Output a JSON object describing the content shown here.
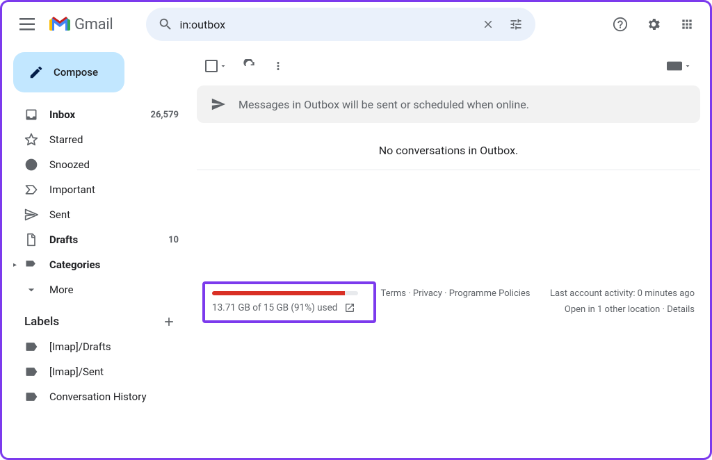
{
  "header": {
    "app_name": "Gmail",
    "search_value": "in:outbox"
  },
  "compose_label": "Compose",
  "nav": [
    {
      "icon": "inbox",
      "label": "Inbox",
      "count": "26,579",
      "bold": true
    },
    {
      "icon": "star",
      "label": "Starred",
      "count": "",
      "bold": false
    },
    {
      "icon": "clock",
      "label": "Snoozed",
      "count": "",
      "bold": false
    },
    {
      "icon": "important",
      "label": "Important",
      "count": "",
      "bold": false
    },
    {
      "icon": "send",
      "label": "Sent",
      "count": "",
      "bold": false
    },
    {
      "icon": "file",
      "label": "Drafts",
      "count": "10",
      "bold": true
    },
    {
      "icon": "category",
      "label": "Categories",
      "count": "",
      "bold": true
    },
    {
      "icon": "more",
      "label": "More",
      "count": "",
      "bold": false
    }
  ],
  "labels_title": "Labels",
  "labels": [
    {
      "label": "[Imap]/Drafts"
    },
    {
      "label": "[Imap]/Sent"
    },
    {
      "label": "Conversation History"
    }
  ],
  "banner_text": "Messages in Outbox will be sent or scheduled when online.",
  "empty_text": "No conversations in Outbox.",
  "storage": {
    "percent": 91,
    "text": "13.71 GB of 15 GB (91%) used"
  },
  "footer_links": {
    "terms": "Terms",
    "privacy": "Privacy",
    "policies": "Programme Policies"
  },
  "activity": {
    "line1": "Last account activity: 0 minutes ago",
    "line2_prefix": "Open in 1 other location",
    "details": "Details"
  }
}
